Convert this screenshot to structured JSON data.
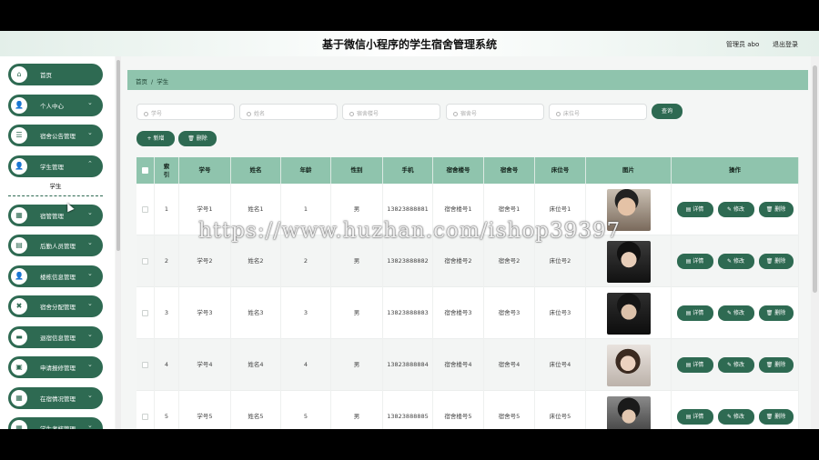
{
  "header": {
    "title": "基于微信小程序的学生宿舍管理系统",
    "admin": "管理员 abo",
    "logout": "退出登录"
  },
  "sidebar": {
    "items": [
      {
        "label": "首页",
        "icon": "⌂",
        "icon_name": "home-icon",
        "chevron": ""
      },
      {
        "label": "个人中心",
        "icon": "👤",
        "icon_name": "user-icon",
        "chevron": "⌄"
      },
      {
        "label": "宿舍公告管理",
        "icon": "☰",
        "icon_name": "list-icon",
        "chevron": "⌄"
      },
      {
        "label": "学生管理",
        "icon": "👤",
        "icon_name": "user-icon",
        "chevron": "⌃"
      },
      {
        "label": "宿管管理",
        "icon": "▦",
        "icon_name": "grid-icon",
        "chevron": "⌄"
      },
      {
        "label": "后勤人员管理",
        "icon": "▤",
        "icon_name": "staff-icon",
        "chevron": "⌄"
      },
      {
        "label": "楼栋信息管理",
        "icon": "👤",
        "icon_name": "building-icon",
        "chevron": "⌄"
      },
      {
        "label": "宿舍分配管理",
        "icon": "✖",
        "icon_name": "tools-icon",
        "chevron": "⌄"
      },
      {
        "label": "退宿信息管理",
        "icon": "▬",
        "icon_name": "card-icon",
        "chevron": "⌄"
      },
      {
        "label": "申请报修管理",
        "icon": "▣",
        "icon_name": "repair-icon",
        "chevron": "⌄"
      },
      {
        "label": "在宿情况管理",
        "icon": "▦",
        "icon_name": "grid-icon",
        "chevron": "⌄"
      },
      {
        "label": "学生考核管理",
        "icon": "▦",
        "icon_name": "grid-icon",
        "chevron": "⌄"
      }
    ],
    "submenu": "学生"
  },
  "breadcrumb": {
    "home": "首页",
    "sep": "/",
    "current": "学生"
  },
  "search": {
    "fields": [
      "学号",
      "姓名",
      "宿舍楼号",
      "宿舍号",
      "床位号"
    ],
    "button": "查询"
  },
  "actions": {
    "add": "+ 新增",
    "delete": "🗑 删除"
  },
  "table": {
    "headers": [
      "",
      "索引",
      "学号",
      "姓名",
      "年龄",
      "性别",
      "手机",
      "宿舍楼号",
      "宿舍号",
      "床位号",
      "图片",
      "操作"
    ],
    "rows": [
      {
        "index": "1",
        "id": "学号1",
        "name": "姓名1",
        "age": "1",
        "gender": "男",
        "phone": "13823888881",
        "building": "宿舍楼号1",
        "room": "宿舍号1",
        "bed": "床位号1"
      },
      {
        "index": "2",
        "id": "学号2",
        "name": "姓名2",
        "age": "2",
        "gender": "男",
        "phone": "13823888882",
        "building": "宿舍楼号2",
        "room": "宿舍号2",
        "bed": "床位号2"
      },
      {
        "index": "3",
        "id": "学号3",
        "name": "姓名3",
        "age": "3",
        "gender": "男",
        "phone": "13823888883",
        "building": "宿舍楼号3",
        "room": "宿舍号3",
        "bed": "床位号3"
      },
      {
        "index": "4",
        "id": "学号4",
        "name": "姓名4",
        "age": "4",
        "gender": "男",
        "phone": "13823888884",
        "building": "宿舍楼号4",
        "room": "宿舍号4",
        "bed": "床位号4"
      },
      {
        "index": "5",
        "id": "学号5",
        "name": "姓名5",
        "age": "5",
        "gender": "男",
        "phone": "13823888885",
        "building": "宿舍楼号5",
        "room": "宿舍号5",
        "bed": "床位号5"
      }
    ],
    "ops": {
      "detail": "详情",
      "edit": "修改",
      "delete": "删除"
    }
  },
  "watermark": "https://www.huzhan.com/ishop39397",
  "colors": {
    "accent": "#2e6a52",
    "header_bg": "#8fc4ad"
  }
}
